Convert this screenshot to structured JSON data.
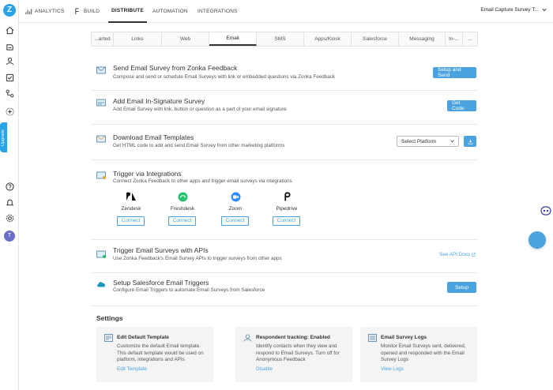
{
  "rail": {
    "logo": "Z",
    "upgrade": "Upgrade",
    "avatar": "T"
  },
  "topnav": [
    {
      "label": "ANALYTICS",
      "icon": "chart-icon"
    },
    {
      "label": "BUILD",
      "icon": "build-icon"
    },
    {
      "label": "DISTRIBUTE",
      "active": true
    },
    {
      "label": "AUTOMATION"
    },
    {
      "label": "INTEGRATIONS"
    }
  ],
  "survey_select": "Email Capture Survey T...",
  "tabs": [
    "...arted",
    "Links",
    "Web",
    "Email",
    "SMS",
    "Apps/Kiosk",
    "Salesforce",
    "Messaging",
    "In-...",
    "..."
  ],
  "rows": {
    "send": {
      "title": "Send Email Survey from Zonka Feedback",
      "desc": "Compose and send or schedule Email Surveys with link or embedded questions via Zonka Feedback",
      "button": "Setup and Send"
    },
    "signature": {
      "title": "Add Email In-Signature Survey",
      "desc": "Add Email Survey with link, button or question as a part of your email signature",
      "button": "Get Code"
    },
    "templates": {
      "title": "Download Email Templates",
      "desc": "Get HTML code to add and send Email Survey from other marketing platforms",
      "select": "Select Platform"
    },
    "integrations": {
      "title": "Trigger via Integrations",
      "desc": "Connect Zonka Feedback to other apps and trigger email surveys via integrations",
      "connect": "Connect",
      "apps": [
        "Zendesk",
        "Freshdesk",
        "Zoom",
        "Pipedrive"
      ]
    },
    "apis": {
      "title": "Trigger Email Surveys with APIs",
      "desc": "Use Zonka Feedback's Email Survey APIs to trigger surveys from other apps",
      "link": "See API Docs"
    },
    "salesforce": {
      "title": "Setup Salesforce Email Triggers",
      "desc": "Configure Email Triggers to automate Email Surveys from Salesforce",
      "button": "Setup"
    }
  },
  "settings": {
    "title": "Settings",
    "cards": [
      {
        "title": "Edit Default Template",
        "desc": "Customize the default Email template. This default template would be used on platform, integrations and APIs",
        "link": "Edit Template"
      },
      {
        "title": "Respondent tracking: Enabled",
        "desc": "Identify contacts when they view and respond to Email Surveys. Turn off for Anonymous Feedback",
        "link": "Disable"
      },
      {
        "title": "Email Survey Logs",
        "desc": "Monitor Email Surveys sent, delivered, opened and responded with the Email Survey Logs",
        "link": "View Logs"
      }
    ]
  },
  "colors": {
    "accent": "#4aa3df",
    "brand": "#2ba3e8"
  }
}
